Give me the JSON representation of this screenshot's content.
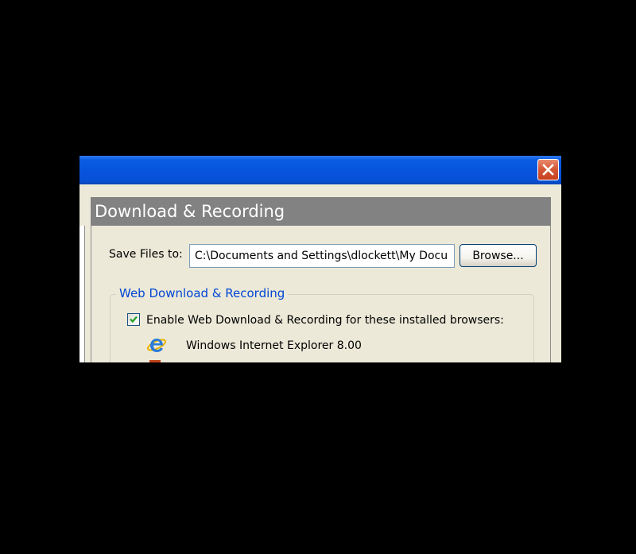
{
  "window": {
    "close_icon": "close-icon"
  },
  "section": {
    "title": "Download & Recording"
  },
  "save_files": {
    "label": "Save Files to:",
    "path_value": "C:\\Documents and Settings\\dlockett\\My Docu",
    "browse_label": "Browse..."
  },
  "web_download": {
    "group_title": "Web Download & Recording",
    "enable_label": "Enable Web Download & Recording for these installed browsers:",
    "enable_checked": true,
    "browsers": [
      {
        "name": "Windows Internet Explorer 8.00",
        "icon": "internet-explorer-icon"
      }
    ]
  },
  "colors": {
    "titlebar": "#0854DD",
    "header_bg": "#828282",
    "group_title": "#0046D5",
    "dialog_bg": "#ECE9D8",
    "close_button": "#D65A37"
  }
}
